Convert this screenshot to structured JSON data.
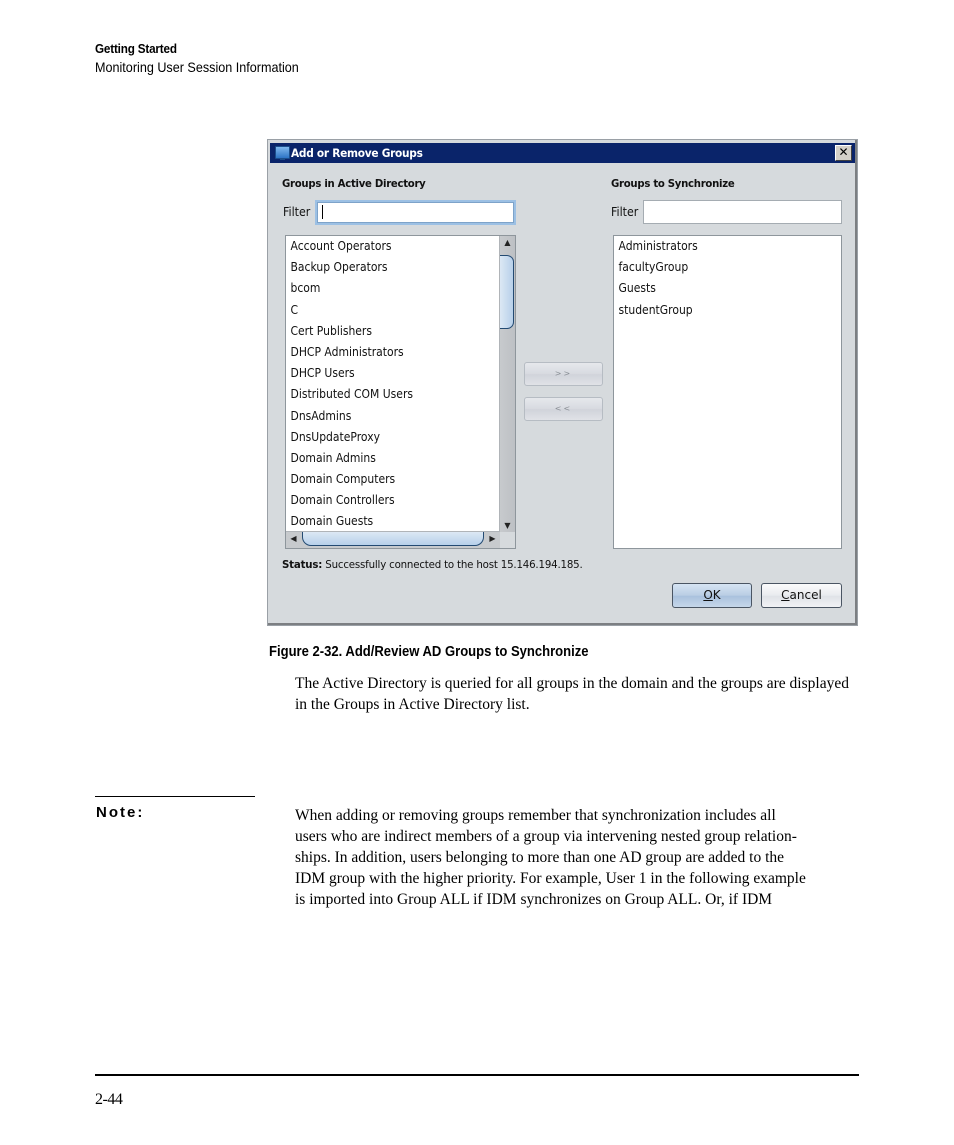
{
  "header": {
    "chapter": "Getting Started",
    "section": "Monitoring User Session Information"
  },
  "dialog": {
    "title": "Add or Remove Groups",
    "close_symbol": "✕",
    "left_panel": {
      "label": "Groups in Active Directory",
      "filter_label": "Filter",
      "filter_value": "",
      "items": [
        "Account Operators",
        "Backup Operators",
        "bcom",
        "C",
        "Cert Publishers",
        "DHCP Administrators",
        "DHCP Users",
        "Distributed COM Users",
        "DnsAdmins",
        "DnsUpdateProxy",
        "Domain Admins",
        "Domain Computers",
        "Domain Controllers",
        "Domain Guests"
      ]
    },
    "right_panel": {
      "label": "Groups to Synchronize",
      "filter_label": "Filter",
      "filter_value": "",
      "items": [
        "Administrators",
        "facultyGroup",
        "Guests",
        "studentGroup"
      ]
    },
    "add_button": ">>",
    "remove_button": "<<",
    "status_label": "Status:",
    "status_text": " Successfully connected to the host 15.146.194.185.",
    "ok_button": {
      "mnemonic": "O",
      "rest": "K"
    },
    "cancel_button": {
      "mnemonic": "C",
      "rest": "ancel"
    }
  },
  "figure_caption": "Figure 2-32. Add/Review AD Groups to Synchronize",
  "body_paragraph": "The Active Directory is queried for all groups in the domain and the groups are displayed in the Groups in Active Directory list.",
  "note": {
    "label": "Note:",
    "lines": [
      "When adding or removing groups remember that synchronization includes all",
      "users who are indirect members of a group via intervening nested group relation-",
      "ships. In addition, users belonging to more than one AD group are added to the",
      "IDM group with the higher priority. For example, User 1 in the following example",
      "is imported into Group ALL if IDM synchronizes on Group ALL. Or, if IDM"
    ]
  },
  "footer": {
    "page_number": "2-44"
  }
}
